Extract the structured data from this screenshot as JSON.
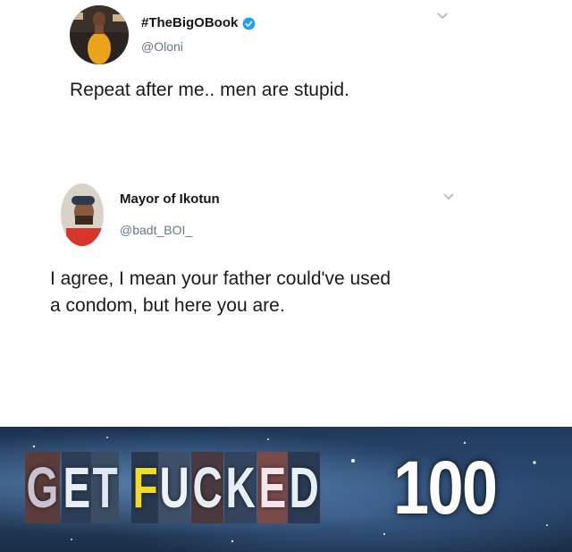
{
  "tweet1": {
    "display_name": "#TheBigOBook",
    "handle": "@Oloni",
    "text": "Repeat after me.. men are stupid.",
    "verified": true
  },
  "tweet2": {
    "display_name": "Mayor of Ikotun",
    "handle": "@badt_BOI_",
    "text_line1": "I agree, I mean your father could've used",
    "text_line2": "a condom, but here you are."
  },
  "banner": {
    "letters": [
      "G",
      "E",
      "T",
      "F",
      "U",
      "C",
      "K",
      "E",
      "D"
    ],
    "score": "100"
  },
  "colors": {
    "verified": "#1da1f2",
    "handle": "#657786",
    "chevron": "#aab8c2"
  }
}
